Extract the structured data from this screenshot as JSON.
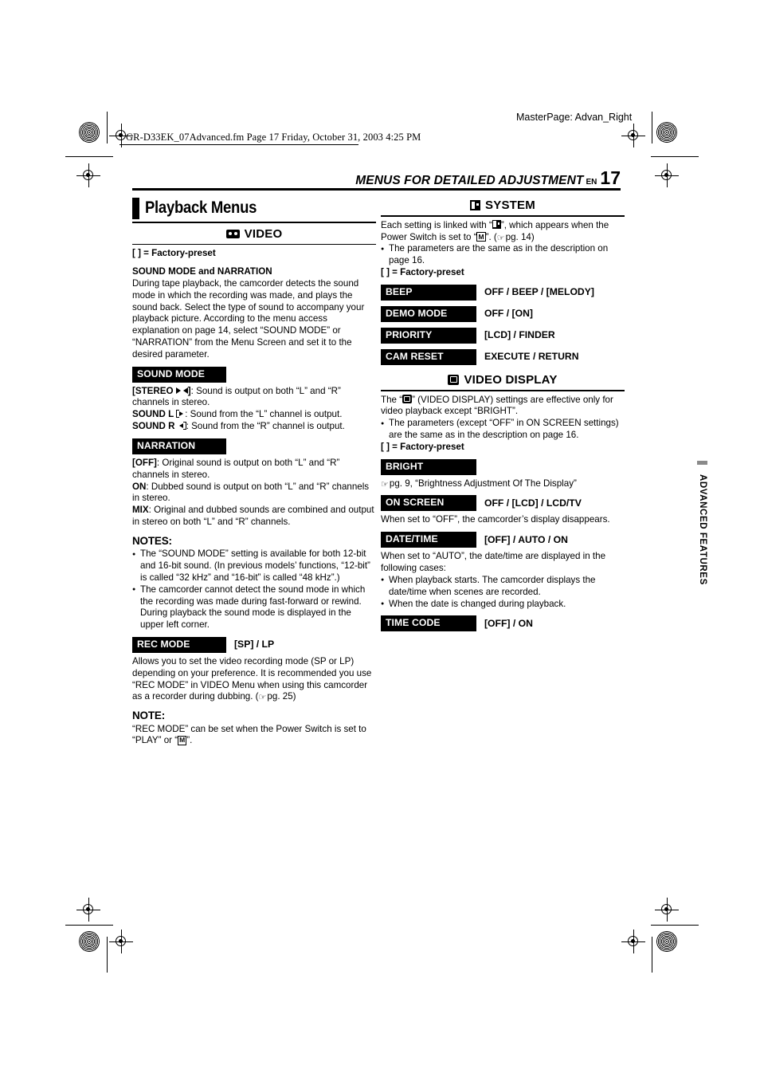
{
  "page": {
    "masterpage": "MasterPage: Advan_Right",
    "slug": "GR-D33EK_07Advanced.fm  Page 17  Friday, October 31, 2003  4:25 PM",
    "running_head": "MENUS FOR DETAILED ADJUSTMENT",
    "lang_code": "EN",
    "page_number": "17",
    "thumb_tab": "ADVANCED FEATURES",
    "thumb_tab_color": "#8a8a8a"
  },
  "left_column": {
    "section_title": "Playback Menus",
    "video_heading": "VIDEO",
    "video_icon": "cassette-tape-icon",
    "factory_preset_note": "[  ] = Factory-preset",
    "sound_mode_narration": {
      "heading": "SOUND MODE and NARRATION",
      "body": "During tape playback, the camcorder detects the sound mode in which the recording was made, and plays the sound back. Select the type of sound to accompany your playback picture. According to the menu access explanation on page 14, select “SOUND MODE” or “NARRATION” from the Menu Screen and set it to the desired parameter."
    },
    "sound_mode": {
      "chip": "SOUND MODE",
      "options": [
        {
          "label": "[STEREO",
          "icon": "stereo-speakers-icon",
          "label_tail": "]",
          "text": ": Sound is output on both “L” and “R” channels in stereo."
        },
        {
          "label": "SOUND L",
          "icon": "sound-left-icon",
          "label_tail": "",
          "text": ": Sound from the “L” channel is output."
        },
        {
          "label": "SOUND R",
          "icon": "sound-right-icon",
          "label_tail": "",
          "text": ": Sound from the “R” channel is output."
        }
      ]
    },
    "narration": {
      "chip": "NARRATION",
      "options": [
        {
          "label": "[OFF]",
          "text": ": Original sound is output on both “L” and “R” channels in stereo."
        },
        {
          "label": "ON",
          "text": ": Dubbed sound is output on both “L” and “R” channels in stereo."
        },
        {
          "label": "MIX",
          "text": ": Original and dubbed sounds are combined and output in stereo on both “L” and “R” channels."
        }
      ]
    },
    "notes": {
      "heading": "NOTES:",
      "items": [
        "The “SOUND MODE” setting is available for both 12-bit and 16-bit sound. (In previous models’ functions, “12-bit” is called “32 kHz” and “16-bit” is called “48 kHz”.)",
        "The camcorder cannot detect the sound mode in which the recording was made during fast-forward or rewind. During playback the sound mode is displayed in the upper left corner."
      ]
    },
    "rec_mode": {
      "chip": "REC MODE",
      "values_bracketed": "[SP]",
      "values_rest": " / LP",
      "body_before_ref": "Allows you to set the video recording mode (SP or LP) depending on your preference. It is recommended you use “REC MODE” in VIDEO Menu when using this camcorder as a recorder during dubbing. (",
      "body_ref": "pg. 25",
      "body_after_ref": ")",
      "note_heading": "NOTE:",
      "note_before_icon": "“REC MODE” can be set when the Power Switch is set to “PLAY” or “",
      "note_icon_letter": "M",
      "note_after_icon": "”."
    }
  },
  "right_column": {
    "system": {
      "heading": "SYSTEM",
      "icon": "system-icon",
      "intro_part1": "Each setting is linked with “",
      "intro_part2": "”, which appears when the Power Switch is set to “",
      "intro_icon_letter": "M",
      "intro_part3": "”. (",
      "intro_ref": "pg. 14",
      "intro_part4": ")",
      "bullet": "The parameters are the same as in the description on page 16.",
      "factory_preset_note": "[  ] = Factory-preset",
      "items": [
        {
          "chip": "BEEP",
          "values": "OFF / BEEP / [MELODY]"
        },
        {
          "chip": "DEMO MODE",
          "values": "OFF / [ON]"
        },
        {
          "chip": "PRIORITY",
          "values": "[LCD] / FINDER"
        },
        {
          "chip": "CAM RESET",
          "values": "EXECUTE / RETURN"
        }
      ]
    },
    "video_display": {
      "heading": "VIDEO DISPLAY",
      "icon": "video-display-icon",
      "intro_part1": "The “",
      "intro_part2": "” (VIDEO DISPLAY) settings are effective only for video playback except “BRIGHT”.",
      "bullet": "The parameters (except “OFF” in ON SCREEN settings) are the same as in the description on page 16.",
      "factory_preset_note": "[  ] = Factory-preset",
      "bright": {
        "chip": "BRIGHT",
        "ref_text": "pg. 9, “Brightness Adjustment Of The Display”"
      },
      "on_screen": {
        "chip": "ON SCREEN",
        "values": "OFF / [LCD] / LCD/TV",
        "body": "When set to “OFF”, the camcorder’s display disappears."
      },
      "date_time": {
        "chip": "DATE/TIME",
        "values": "[OFF] / AUTO / ON",
        "body": "When set to “AUTO”, the date/time are displayed in the following cases:",
        "bullets": [
          "When playback starts. The camcorder displays the date/time when scenes are recorded.",
          "When the date is changed during playback."
        ]
      },
      "time_code": {
        "chip": "TIME CODE",
        "values": "[OFF] / ON"
      }
    }
  }
}
